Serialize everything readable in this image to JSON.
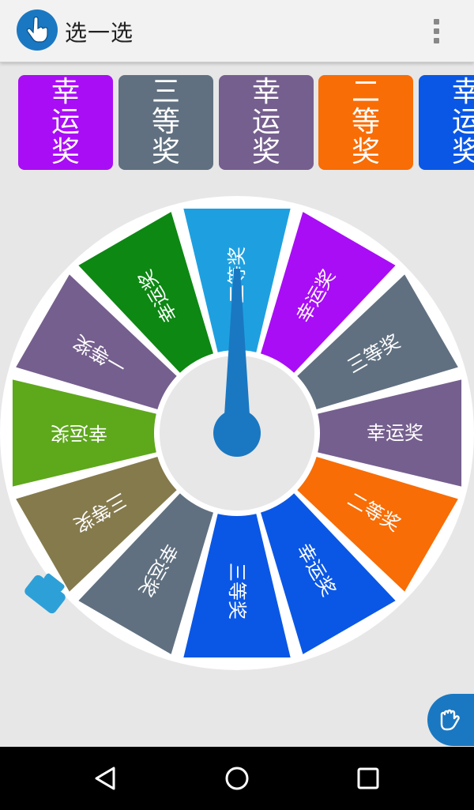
{
  "app": {
    "title": "选一选",
    "icon": "hand-pointer-icon"
  },
  "menu": {
    "icon": "more-vert-icon"
  },
  "chips": [
    {
      "label": "幸运奖",
      "color": "#a90df5"
    },
    {
      "label": "三等奖",
      "color": "#607080"
    },
    {
      "label": "幸运奖",
      "color": "#755f8e"
    },
    {
      "label": "二等奖",
      "color": "#f86d05"
    },
    {
      "label": "幸运奖",
      "color": "#0a57e5"
    }
  ],
  "wheel": {
    "pointer_color": "#1a78c2",
    "handle_color": "#2ea0d8",
    "segments": [
      {
        "label": "二等奖",
        "color": "#1ea0e0"
      },
      {
        "label": "幸运奖",
        "color": "#a90df5"
      },
      {
        "label": "三等奖",
        "color": "#607080"
      },
      {
        "label": "幸运奖",
        "color": "#755f8e"
      },
      {
        "label": "二等奖",
        "color": "#f86d05"
      },
      {
        "label": "幸运奖",
        "color": "#0a57e5"
      },
      {
        "label": "三等奖",
        "color": "#0a57e5"
      },
      {
        "label": "幸运奖",
        "color": "#607080"
      },
      {
        "label": "三等奖",
        "color": "#857a4c"
      },
      {
        "label": "幸运奖",
        "color": "#5ea81c"
      },
      {
        "label": "一等奖",
        "color": "#755f8e"
      },
      {
        "label": "幸运奖",
        "color": "#0d8813"
      }
    ]
  },
  "fab": {
    "icon": "hand-grab-icon"
  },
  "navbar": {
    "back": "back-triangle-icon",
    "home": "home-circle-icon",
    "recents": "recents-square-icon"
  }
}
